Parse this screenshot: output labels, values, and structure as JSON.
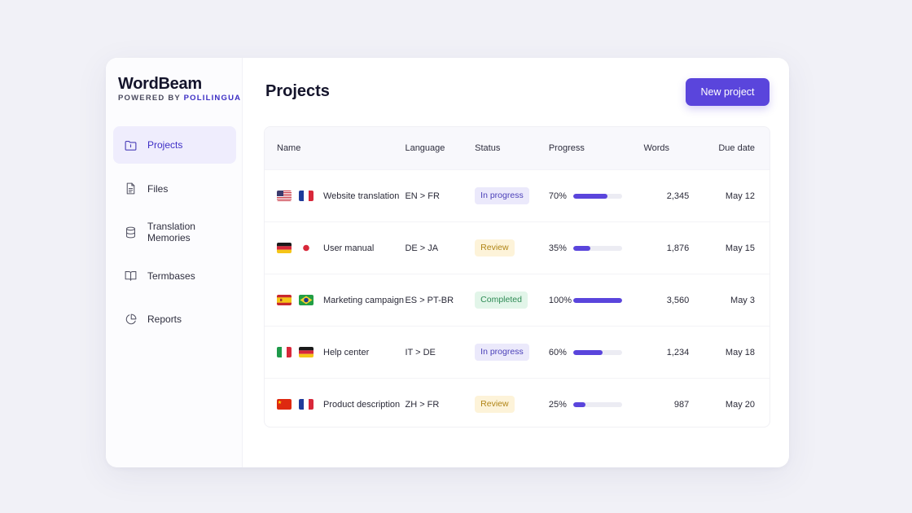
{
  "app": {
    "title": "WordBeam",
    "powered_prefix": "POWERED BY",
    "powered_brand": "POLILINGUA"
  },
  "sidebar": {
    "items": [
      {
        "label": "Projects",
        "icon": "folder-icon",
        "active": true
      },
      {
        "label": "Files",
        "icon": "file-icon",
        "active": false
      },
      {
        "label": "Translation Memories",
        "icon": "database-icon",
        "active": false
      },
      {
        "label": "Termbases",
        "icon": "book-icon",
        "active": false
      },
      {
        "label": "Reports",
        "icon": "pie-chart-icon",
        "active": false
      }
    ]
  },
  "main": {
    "title": "Projects",
    "new_button": "New project"
  },
  "table": {
    "headers": {
      "name": "Name",
      "language": "Language",
      "status": "Status",
      "progress": "Progress",
      "words": "Words",
      "due": "Due date"
    },
    "rows": [
      {
        "flags": [
          "us",
          "fr"
        ],
        "name": "Website translation",
        "language": "EN > FR",
        "status": "In progress",
        "status_type": "inprogress",
        "progress_label": "70%",
        "progress": 0.7,
        "words": "2,345",
        "due": "May 12"
      },
      {
        "flags": [
          "de",
          "jp"
        ],
        "name": "User manual",
        "language": "DE > JA",
        "status": "Review",
        "status_type": "review",
        "progress_label": "35%",
        "progress": 0.35,
        "words": "1,876",
        "due": "May 15"
      },
      {
        "flags": [
          "es",
          "br"
        ],
        "name": "Marketing campaign",
        "language": "ES > PT-BR",
        "status": "Completed",
        "status_type": "completed",
        "progress_label": "100%",
        "progress": 1.0,
        "words": "3,560",
        "due": "May 3"
      },
      {
        "flags": [
          "it",
          "de"
        ],
        "name": "Help center",
        "language": "IT > DE",
        "status": "In progress",
        "status_type": "inprogress",
        "progress_label": "60%",
        "progress": 0.6,
        "words": "1,234",
        "due": "May 18"
      },
      {
        "flags": [
          "cn",
          "fr"
        ],
        "name": "Product description",
        "language": "ZH > FR",
        "status": "Review",
        "status_type": "review",
        "progress_label": "25%",
        "progress": 0.25,
        "words": "987",
        "due": "May 20"
      }
    ]
  },
  "colors": {
    "accent": "#5a45dc",
    "background": "#f1f1f7"
  }
}
